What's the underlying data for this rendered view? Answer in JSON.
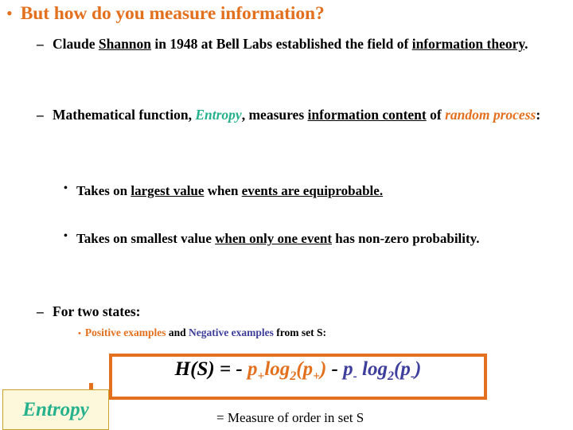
{
  "slide": {
    "title": {
      "bullet": "bullet-dot",
      "text": "But how do you measure information?",
      "color": "#E2701E"
    },
    "points": [
      {
        "dash": "–",
        "segments": [
          {
            "text": "Claude "
          },
          {
            "text": "Shannon",
            "style": "underline"
          },
          {
            "text": " in 1948 at Bell Labs established the field of "
          },
          {
            "text": "information theory",
            "style": "underline"
          },
          {
            "text": "."
          }
        ]
      },
      {
        "dash": "–",
        "segments": [
          {
            "text": "Mathematical function, "
          },
          {
            "text": "Entropy",
            "style": "bold-italic",
            "color": "#26B18D"
          },
          {
            "text": ", measures "
          },
          {
            "text": "information content",
            "style": "underline"
          },
          {
            "text": " of "
          },
          {
            "text": "random process",
            "style": "bold-italic",
            "color": "#E2701E"
          },
          {
            "text": ":"
          }
        ]
      }
    ],
    "sub_points": [
      {
        "dot": "•",
        "segments": [
          {
            "text": "Takes on "
          },
          {
            "text": "largest value",
            "style": "underline"
          },
          {
            "text": " when "
          },
          {
            "text": "events are equiprobable.",
            "style": "underline"
          }
        ]
      },
      {
        "dot": "•",
        "segments": [
          {
            "text": "Takes on smallest value "
          },
          {
            "text": "when only one event",
            "style": "underline"
          },
          {
            "text": " has non-zero probability."
          }
        ]
      }
    ],
    "two_states": {
      "dash": "–",
      "text": "For two states:"
    },
    "examples_line": {
      "dot": "•",
      "positive": "Positive examples",
      "positive_color": "#E2701E",
      "conjunction": " and ",
      "negative": "Negative examples",
      "negative_color": "#3E3E9C",
      "suffix": " from set S:"
    },
    "formula": {
      "lhs": "H(S)",
      "equals": " = ",
      "minus1": "- ",
      "p_plus_1": "p",
      "plus_sub_1": "+",
      "log1": "log",
      "base1": "2",
      "open1": "(",
      "p_plus_2": "p",
      "plus_sub_2": "+",
      "close1": ")",
      "minus2": " - ",
      "p_minus_1": "p",
      "minus_sub_1": "-",
      "log2": "log",
      "base2": "2",
      "open2": "(",
      "p_minus_2": "p",
      "minus_sub_2": "-",
      "close2": ")",
      "plain_text": "H(S) = - p+log2(p+) - p- log2(p-)",
      "border_color": "#E2701E",
      "positive_term_color": "#E2701E",
      "negative_term_color": "#3E3E9C"
    },
    "entropy_callout": {
      "label": "Entropy",
      "text_color": "#26B18D",
      "fill": "#FDF8DC",
      "border": "#C9A227"
    },
    "caption": "= Measure of order in set S"
  }
}
